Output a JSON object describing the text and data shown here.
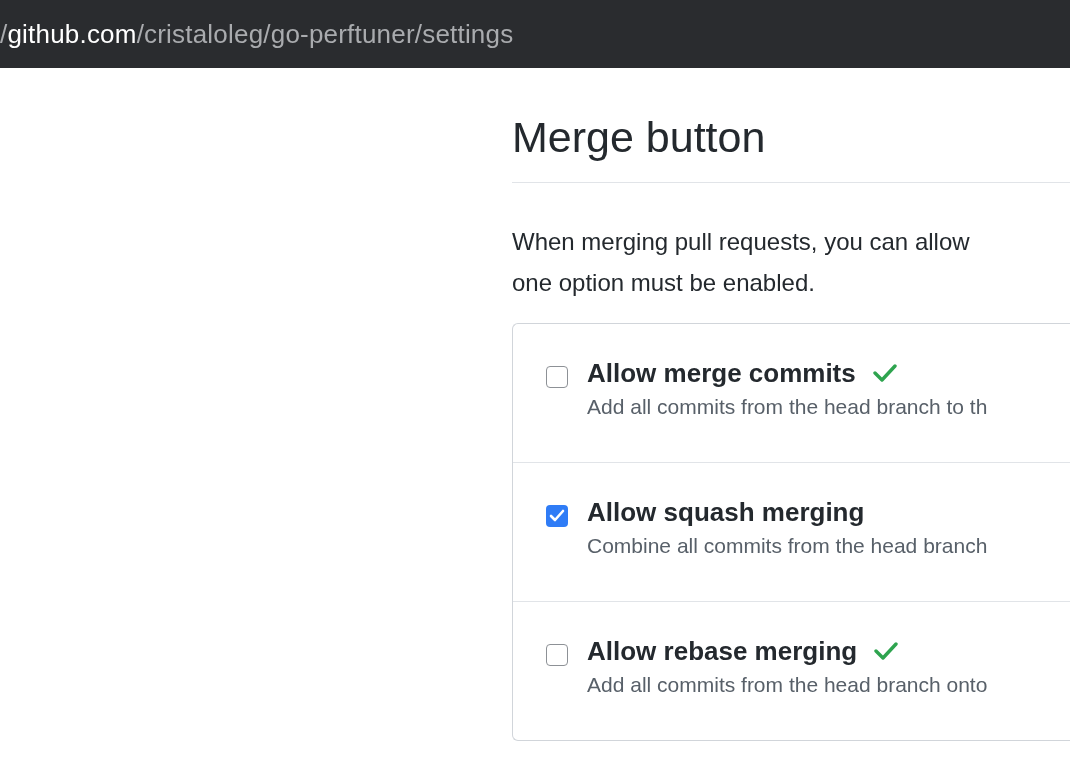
{
  "address_bar": {
    "prefix": "/",
    "host": "github.com",
    "path": "/cristaloleg/go-perftuner/settings"
  },
  "section": {
    "title": "Merge button",
    "description": [
      "When merging pull requests, you can allow",
      "one option must be enabled."
    ]
  },
  "options": [
    {
      "label": "Allow merge commits",
      "checked": false,
      "saved": true,
      "description": "Add all commits from the head branch to th"
    },
    {
      "label": "Allow squash merging",
      "checked": true,
      "saved": false,
      "description": "Combine all commits from the head branch"
    },
    {
      "label": "Allow rebase merging",
      "checked": false,
      "saved": true,
      "description": "Add all commits from the head branch onto"
    }
  ]
}
